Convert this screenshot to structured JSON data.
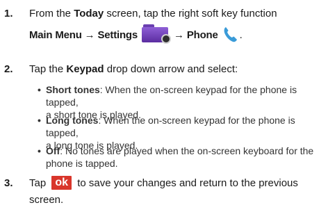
{
  "steps": [
    {
      "number": "1.",
      "line1_prefix": "From the ",
      "line1_bold": "Today",
      "line1_suffix": " screen, tap the right soft key function",
      "line2_part1": "Main Menu",
      "arrow": "→",
      "line2_part2": "Settings",
      "line2_part3": "Phone",
      "line2_end": "."
    },
    {
      "number": "2.",
      "prefix": "Tap the ",
      "bold": "Keypad",
      "suffix": " drop down arrow and select:",
      "options": [
        {
          "bullet": "•",
          "name": "Short tones",
          "line1": ": When the on-screen keypad for the phone is tapped,",
          "line2": "a short tone is played."
        },
        {
          "bullet": "•",
          "name": "Long tones",
          "line1": ": When the on-screen keypad for the phone is tapped,",
          "line2": "a long tone is played."
        },
        {
          "bullet": "•",
          "name": "Off",
          "line1": ": No tones are played when the on-screen keyboard for the",
          "line2": "phone is tapped."
        }
      ]
    },
    {
      "number": "3.",
      "prefix": "Tap ",
      "button_label": "ok",
      "suffix": " to save your changes and return to the previous",
      "line2": "screen."
    }
  ],
  "icons": {
    "settings": "settings-folder-icon",
    "phone": "phone-handset-icon"
  },
  "colors": {
    "ok_button": "#d9362b",
    "settings_icon": "#7a4cc4",
    "phone_icon": "#3a9bd8"
  }
}
